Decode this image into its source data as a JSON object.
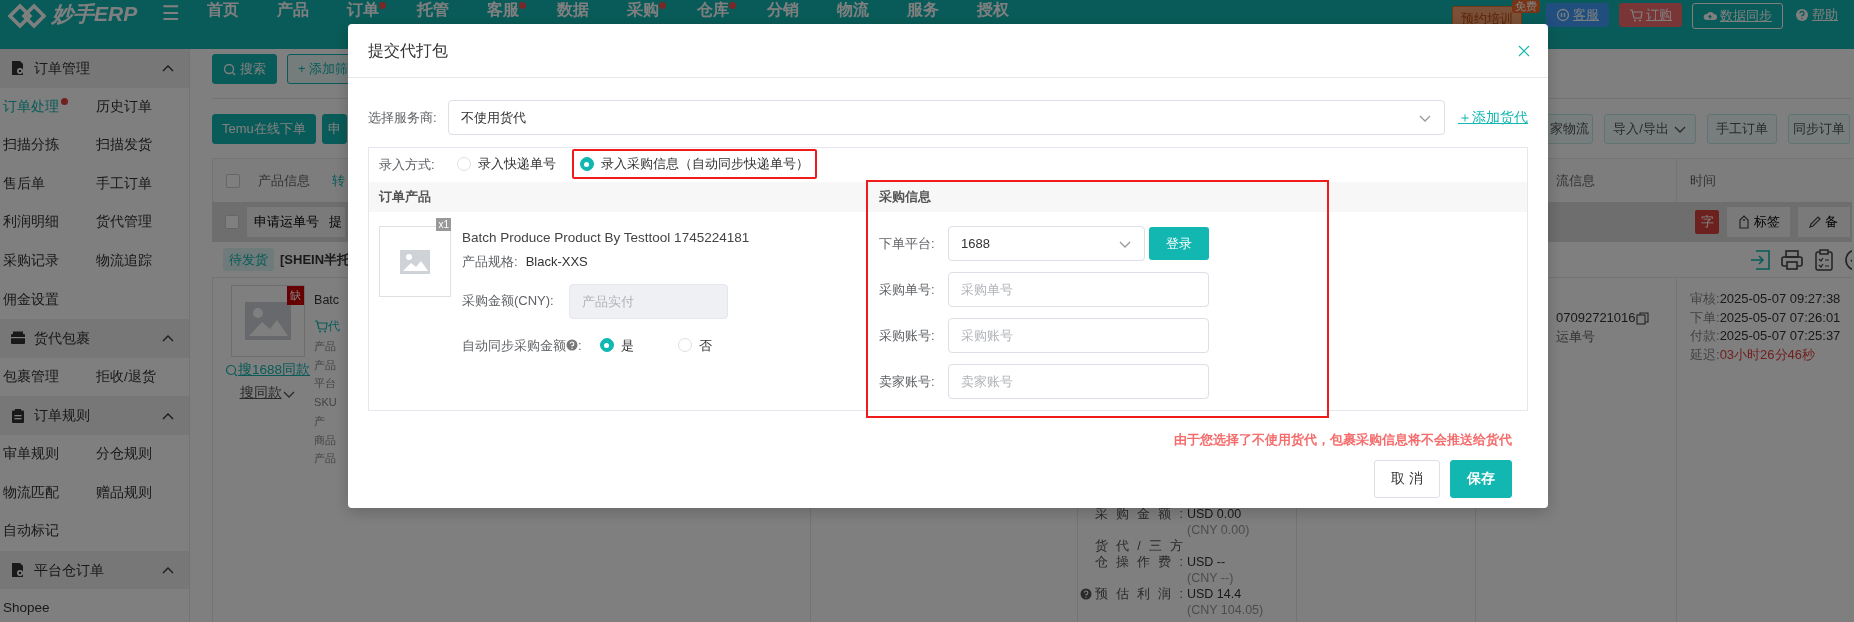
{
  "top_nav": {
    "logo": "妙手ERP",
    "menu_glyph": "☰",
    "items": [
      {
        "label": "首页",
        "dot": false
      },
      {
        "label": "产品",
        "dot": false
      },
      {
        "label": "订单",
        "dot": true
      },
      {
        "label": "托管",
        "dot": false
      },
      {
        "label": "客服",
        "dot": true
      },
      {
        "label": "数据",
        "dot": false
      },
      {
        "label": "采购",
        "dot": true
      },
      {
        "label": "仓库",
        "dot": true
      },
      {
        "label": "分销",
        "dot": false
      },
      {
        "label": "物流",
        "dot": false
      },
      {
        "label": "服务",
        "dot": false
      },
      {
        "label": "授权",
        "dot": false
      }
    ],
    "training": {
      "label": "预约培训",
      "badge": "免费"
    },
    "buttons": [
      {
        "label": "客服",
        "kind": "blue"
      },
      {
        "label": "订购",
        "kind": "red"
      },
      {
        "label": "数据同步",
        "kind": "outline"
      },
      {
        "label": "帮助",
        "kind": "plain"
      }
    ]
  },
  "sidebar": {
    "sections": [
      {
        "title": "订单管理",
        "expanded": true,
        "items": [
          {
            "label": "订单处理",
            "selected": true,
            "dot": true
          },
          {
            "label": "历史订单",
            "selected": false,
            "dot": false
          },
          {
            "label": "扫描分拣",
            "selected": false,
            "dot": false
          },
          {
            "label": "扫描发货",
            "selected": false,
            "dot": false
          },
          {
            "label": "售后单",
            "selected": false,
            "dot": false
          },
          {
            "label": "手工订单",
            "selected": false,
            "dot": false
          },
          {
            "label": "利润明细",
            "selected": false,
            "dot": false
          },
          {
            "label": "货代管理",
            "selected": false,
            "dot": false
          },
          {
            "label": "采购记录",
            "selected": false,
            "dot": false
          },
          {
            "label": "物流追踪",
            "selected": false,
            "dot": false
          },
          {
            "label": "佣金设置",
            "selected": false,
            "dot": false
          }
        ]
      },
      {
        "title": "货代包裹",
        "expanded": true,
        "items": [
          {
            "label": "包裹管理",
            "selected": false,
            "dot": false
          },
          {
            "label": "拒收/退货",
            "selected": false,
            "dot": false
          }
        ]
      },
      {
        "title": "订单规则",
        "expanded": true,
        "items": [
          {
            "label": "审单规则",
            "selected": false,
            "dot": false
          },
          {
            "label": "分仓规则",
            "selected": false,
            "dot": false
          },
          {
            "label": "物流匹配",
            "selected": false,
            "dot": false
          },
          {
            "label": "赠品规则",
            "selected": false,
            "dot": false
          },
          {
            "label": "自动标记",
            "selected": false,
            "dot": false
          }
        ]
      },
      {
        "title": "平台仓订单",
        "expanded": true,
        "items": [
          {
            "label": "Shopee",
            "selected": false,
            "dot": false
          }
        ]
      }
    ]
  },
  "filter_bar": {
    "search": "搜索",
    "add_filter": "+ 添加筛"
  },
  "action_bar": {
    "left": [
      "Temu在线下单",
      "申"
    ],
    "right": [
      {
        "label": "家物流",
        "dropdown": false
      },
      {
        "label": "导入/导出",
        "dropdown": true
      },
      {
        "label": "手工订单",
        "dropdown": false
      },
      {
        "label": "同步订单",
        "dropdown": false
      }
    ]
  },
  "table_header": {
    "checked": false,
    "product": "产品信息",
    "column_2": "转",
    "logistics": "流信息",
    "time": "时间"
  },
  "batch_bar": {
    "checked": false,
    "buttons": [
      "申请运单号",
      "提"
    ],
    "right": [
      {
        "label": "字",
        "kind": "mark"
      },
      {
        "label": "标签",
        "kind": "tag"
      },
      {
        "label": "备",
        "kind": "note"
      }
    ]
  },
  "order": {
    "status": "待发货",
    "title": "[SHEIN半托",
    "product": {
      "missing": "缺",
      "name": "Batc",
      "agent": "代",
      "lines": [
        "产品",
        "产品",
        "平台",
        "SKU",
        "产",
        "商品",
        "产品"
      ],
      "search_links": [
        "搜1688同款",
        "搜同款"
      ]
    },
    "costs": [
      {
        "label_lines": [
          "采购金额:"
        ],
        "value": "USD 0.00",
        "sub": "(CNY 0.00)",
        "help": false
      },
      {
        "label_lines": [
          "货代/三方",
          "仓操作费:"
        ],
        "value": "USD --",
        "sub": "(CNY --)",
        "help": false
      },
      {
        "label_lines": [
          "预估利润:"
        ],
        "value": "USD 14.4",
        "sub": "(CNY 104.05)",
        "help": true
      }
    ],
    "tracking": "07092721016",
    "tracking_label": "运单号",
    "times": [
      {
        "label": "审核:",
        "value": "2025-05-07 09:27:38",
        "kind": "normal"
      },
      {
        "label": "下单:",
        "value": "2025-05-07 07:26:01",
        "kind": "normal"
      },
      {
        "label": "付款:",
        "value": "2025-05-07 07:25:37",
        "kind": "normal"
      },
      {
        "label": "延迟:",
        "value": "03小时26分46秒",
        "kind": "warning"
      }
    ]
  },
  "dialog": {
    "title": "提交代打包",
    "provider": {
      "label": "选择服务商:",
      "value": "不使用货代"
    },
    "add_agent": "＋添加货代",
    "input_method": {
      "label": "录入方式:",
      "options": [
        {
          "label": "录入快递单号",
          "selected": false,
          "highlighted": false
        },
        {
          "label": "录入采购信息（自动同步快递单号）",
          "selected": true,
          "highlighted": true
        }
      ]
    },
    "product_section": {
      "title": "订单产品",
      "quantity": "x1",
      "name": "Batch Produce Product By Testtool 1745224181",
      "spec_label": "产品规格:",
      "spec_value": "Black-XXS",
      "amount_label": "采购金额(CNY):",
      "amount_placeholder": "产品实付",
      "amount_disabled": true,
      "auto_sync_label": "自动同步采购金额",
      "auto_sync_suffix": ":",
      "auto_sync_options": [
        {
          "label": "是",
          "selected": true
        },
        {
          "label": "否",
          "selected": false
        }
      ]
    },
    "purchase_section": {
      "title": "采购信息",
      "highlighted": true,
      "platform_label": "下单平台:",
      "platform_value": "1688",
      "login": "登录",
      "fields": [
        {
          "label": "采购单号:",
          "placeholder": "采购单号"
        },
        {
          "label": "采购账号:",
          "placeholder": "采购账号"
        },
        {
          "label": "卖家账号:",
          "placeholder": "卖家账号"
        }
      ]
    },
    "warning": "由于您选择了不使用货代，包裹采购信息将不会推送给货代",
    "buttons": [
      {
        "label": "取 消",
        "kind": "secondary"
      },
      {
        "label": "保存",
        "kind": "primary"
      }
    ]
  }
}
